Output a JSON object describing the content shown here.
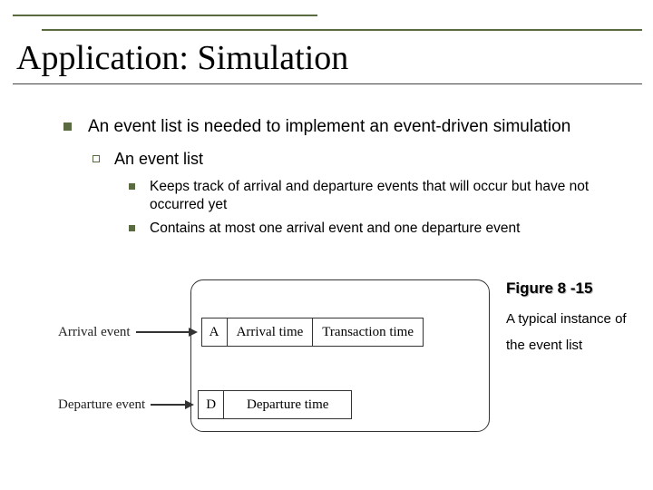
{
  "title": "Application: Simulation",
  "bullets": {
    "l1": "An event list is needed to implement an event-driven simulation",
    "l2": "An event list",
    "l3a": "Keeps track of arrival and departure events that will occur but have not occurred yet",
    "l3b": "Contains at most one arrival event and one departure event"
  },
  "figure": {
    "arrival_label": "Arrival event",
    "departure_label": "Departure event",
    "node_a": {
      "tag": "A",
      "c1": "Arrival time",
      "c2": "Transaction time"
    },
    "node_d": {
      "tag": "D",
      "c1": "Departure time"
    },
    "title": "Figure 8 -15",
    "caption1": "A typical instance of",
    "caption2": "the event list"
  }
}
